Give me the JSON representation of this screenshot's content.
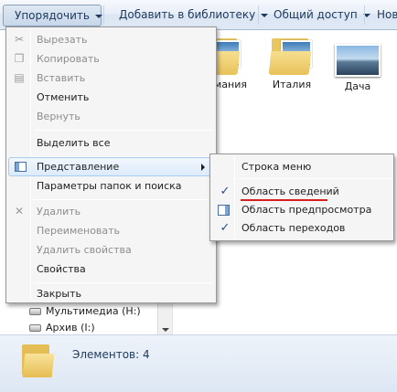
{
  "toolbar": {
    "organize_label": "Упорядочить",
    "add_library_label": "Добавить в библиотеку",
    "share_label": "Общий доступ",
    "next_label": "Нов"
  },
  "content": {
    "folders": [
      {
        "label": "мания",
        "icon": "folder-with-photo"
      },
      {
        "label": "Италия",
        "icon": "folder-with-photo"
      },
      {
        "label": "Дача",
        "icon": "photo"
      }
    ]
  },
  "navigation": {
    "items": [
      {
        "label": "Мультимедиа (H:)",
        "icon": "drive-icon"
      },
      {
        "label": "Архив (I:)",
        "icon": "drive-icon"
      }
    ]
  },
  "status": {
    "items_text": "Элементов: 4"
  },
  "menu": {
    "cut": "Вырезать",
    "copy": "Копировать",
    "paste": "Вставить",
    "undo": "Отменить",
    "redo": "Вернуть",
    "select_all": "Выделить все",
    "view": "Представление",
    "folder_options": "Параметры папок и поиска",
    "delete": "Удалить",
    "rename": "Переименовать",
    "remove_properties": "Удалить свойства",
    "properties": "Свойства",
    "close": "Закрыть"
  },
  "submenu": {
    "menu_bar": "Строка меню",
    "details_pane": "Область сведений",
    "preview_pane": "Область предпросмотра",
    "navigation_pane": "Область переходов",
    "check_mark": "✓",
    "highlight_color": "#d62020"
  }
}
